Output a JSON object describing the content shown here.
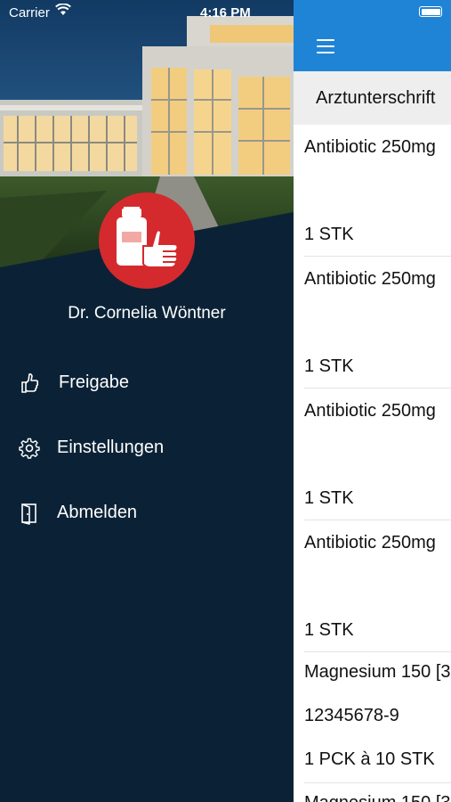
{
  "status_bar": {
    "carrier": "Carrier",
    "time": "4:16 PM"
  },
  "header": {
    "menu_icon": "hamburger-menu-icon",
    "accent": "#1f84d6"
  },
  "section": {
    "title": "Arztunterschrift"
  },
  "list": {
    "items": [
      {
        "name": "Antibiotic 250mg",
        "qty": "1 STK"
      },
      {
        "name": "Antibiotic 250mg",
        "qty": "1 STK"
      },
      {
        "name": "Antibiotic 250mg",
        "qty": "1 STK"
      },
      {
        "name": "Antibiotic 250mg",
        "qty": "1 STK"
      }
    ],
    "extra": [
      {
        "text": "Magnesium 150 [3"
      },
      {
        "text": "12345678-9"
      },
      {
        "text": "1 PCK à 10 STK"
      },
      {
        "text": "Magnesium 150 [3"
      }
    ]
  },
  "drawer": {
    "logo_icon": "medicine-bottle-thumbs-up-icon",
    "logo_color": "#d42a2e",
    "background": "#0b2236",
    "user_name": "Dr. Cornelia Wöntner",
    "menu": [
      {
        "label": "Freigabe",
        "icon": "thumbs-up-icon"
      },
      {
        "label": "Einstellungen",
        "icon": "gear-icon"
      },
      {
        "label": "Abmelden",
        "icon": "logout-door-icon"
      }
    ]
  }
}
